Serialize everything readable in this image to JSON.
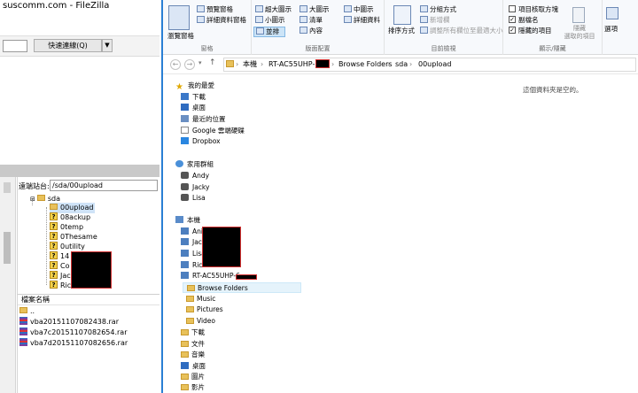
{
  "filezilla": {
    "title": "suscomm.com - FileZilla",
    "quickconnect_label": "快速連線(Q)",
    "quickconnect_dropdown": "▼",
    "remote_site_label": "遠端站台:",
    "remote_site_value": "/sda/00upload",
    "tree_root": "sda",
    "tree_items": [
      "00upload",
      "08ackup",
      "0temp",
      "0Thesame",
      "0utility",
      "14",
      "Co",
      "Jac",
      "Ric"
    ],
    "files_header": "檔案名稱",
    "files": [
      "..",
      "vba20151107082438.rar",
      "vba7c20151107082654.rar",
      "vba7d20151107082656.rar"
    ]
  },
  "explorer": {
    "ribbon": {
      "nav_pane_btn": "瀏覽窗格",
      "preview_pane": "預覽窗格",
      "details_pane": "詳細資料窗格",
      "pane_group": "窗格",
      "layout_items": [
        "超大圖示",
        "大圖示",
        "中圖示",
        "小圖示",
        "清單",
        "詳細資料",
        "並排",
        "內容"
      ],
      "layout_group": "版面配置",
      "sort_btn": "排序方式",
      "group_by": "分組方式",
      "add_column": "新增欄",
      "fit_columns": "調整所有欄位至最適大小",
      "current_view_group": "目前檢視",
      "item_checkbox": "項目核取方塊",
      "file_ext": "副檔名",
      "hidden_items": "隱藏的項目",
      "hide_selected": "隱藏\n選取的項目",
      "show_hide_group": "顯示/隱藏",
      "options": "選項"
    },
    "address": {
      "crumbs": [
        "本機",
        "RT-AC55UHP-6",
        "Browse Folders",
        "sda",
        "00upload"
      ]
    },
    "nav": {
      "favorites": "我的最愛",
      "fav_items": [
        "下載",
        "桌面",
        "最近的位置",
        "Google 雲端硬碟",
        "Dropbox"
      ],
      "homegroup": "家用群組",
      "home_items": [
        "Andy",
        "Jacky",
        "Lisa"
      ],
      "this_pc": "本機",
      "pc_items": [
        "Ani",
        "Jac",
        "Lisa",
        "Ric"
      ],
      "router": "RT-AC55UHP-6",
      "router_items": [
        "Browse Folders",
        "Music",
        "Pictures",
        "Video"
      ],
      "lib_items": [
        "下載",
        "文件",
        "音樂",
        "桌面",
        "圖片",
        "影片"
      ]
    },
    "empty_text": "這個資料夾是空的。"
  }
}
